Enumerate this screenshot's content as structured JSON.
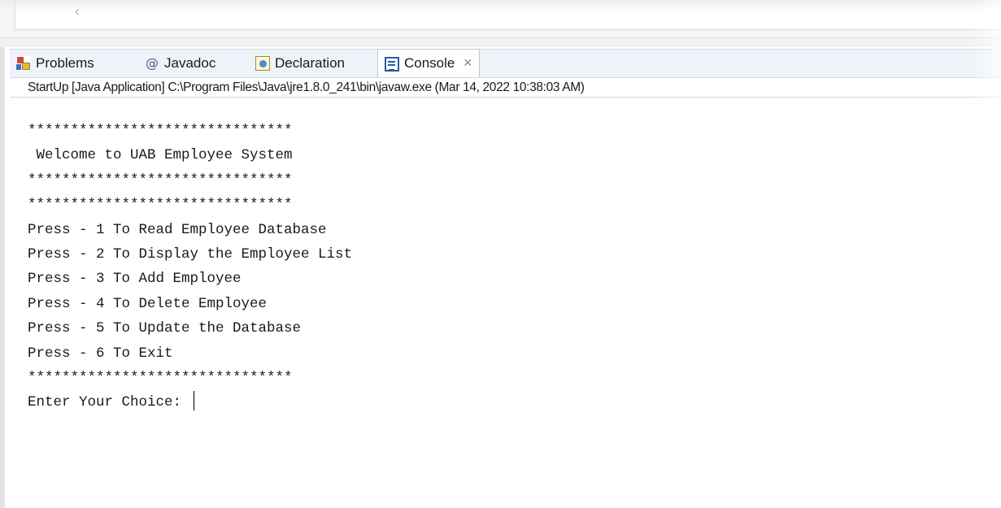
{
  "top_editor": {
    "scroll_left_glyph": "‹"
  },
  "tabs": [
    {
      "label": "Problems",
      "icon": "problems-icon"
    },
    {
      "label": "Javadoc",
      "icon": "at-icon"
    },
    {
      "label": "Declaration",
      "icon": "declaration-icon"
    },
    {
      "label": "Console",
      "icon": "console-icon",
      "active": true,
      "close": "✕"
    }
  ],
  "process_label": "StartUp [Java Application] C:\\Program Files\\Java\\jre1.8.0_241\\bin\\javaw.exe (Mar 14, 2022 10:38:03 AM)",
  "console": {
    "lines": [
      "*******************************",
      " Welcome to UAB Employee System",
      "*******************************",
      "*******************************",
      "Press - 1 To Read Employee Database",
      "Press - 2 To Display the Employee List",
      "Press - 3 To Add Employee",
      "Press - 4 To Delete Employee",
      "Press - 5 To Update the Database",
      "Press - 6 To Exit",
      "*******************************"
    ],
    "prompt": "Enter Your Choice: "
  },
  "colors": {
    "tabbar_bg": "#eef3f9",
    "console_text": "#1a1a1a",
    "console_icon": "#2a5aa0"
  }
}
